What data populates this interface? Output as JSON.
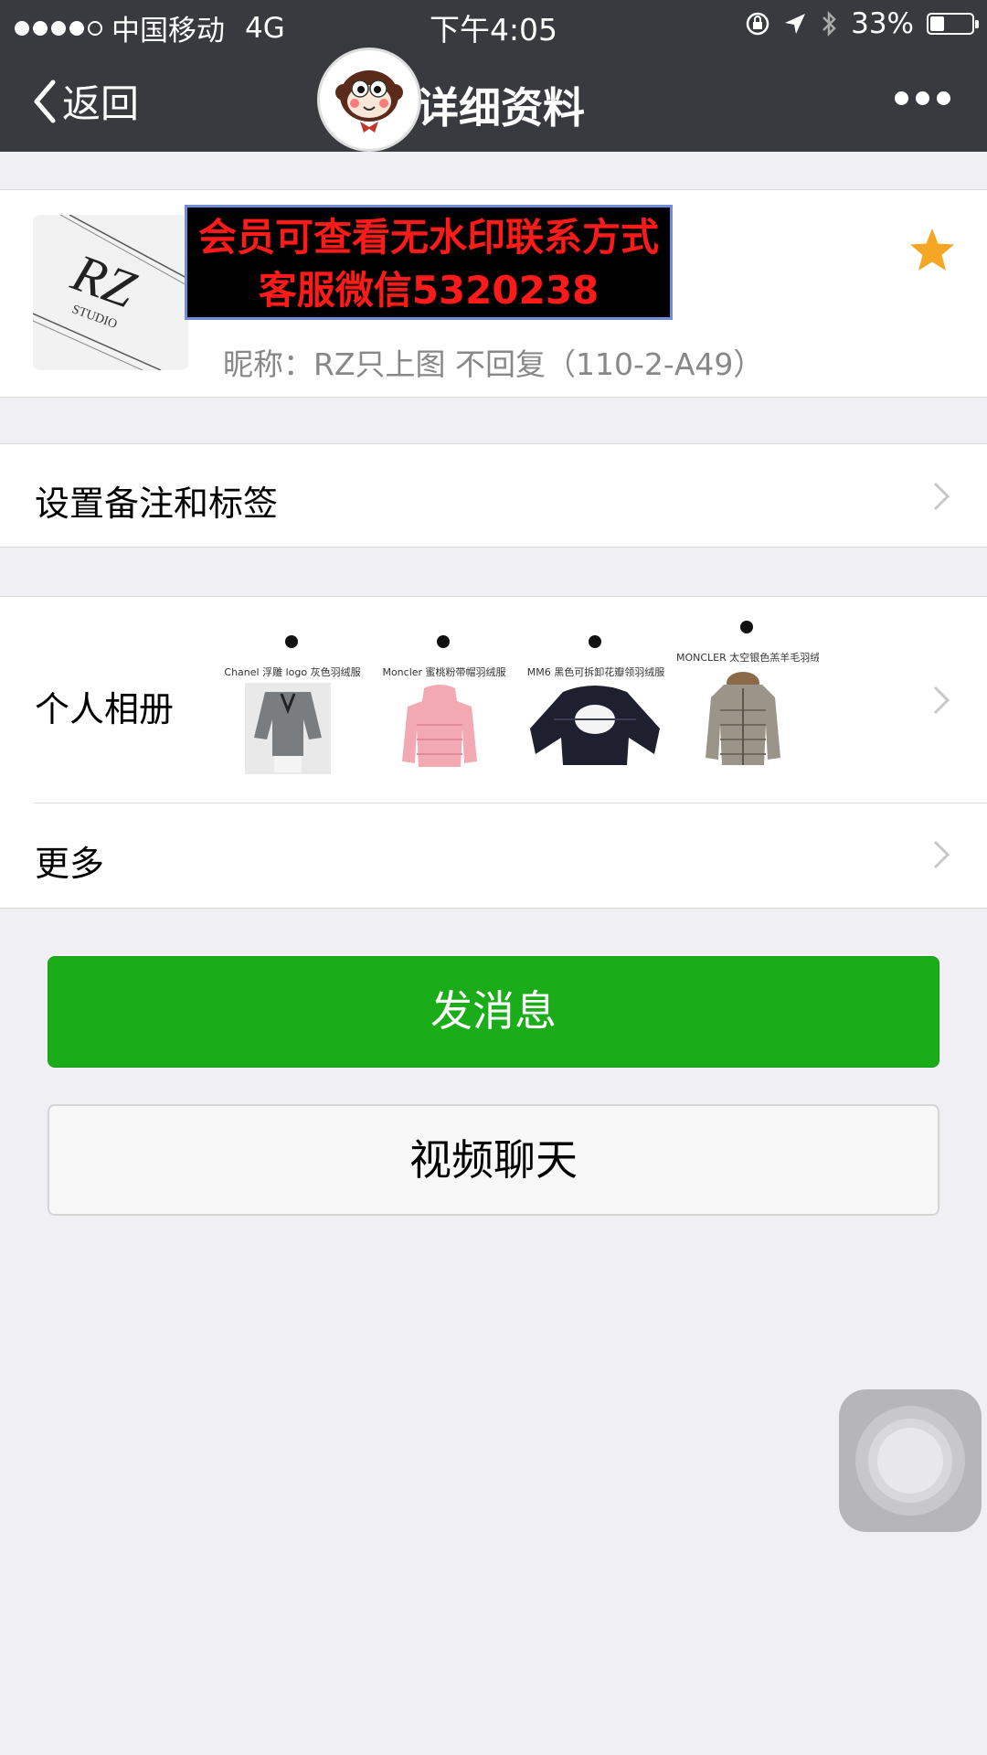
{
  "status_bar": {
    "carrier": "中国移动",
    "network": "4G",
    "time": "下午4:05",
    "battery": "33%",
    "battery_level": 0.33
  },
  "nav": {
    "back_label": "返回",
    "title": "详细资料"
  },
  "profile": {
    "watermark_line1": "会员可查看无水印联系方式",
    "watermark_line2": "客服微信5320238",
    "nickname": "昵称：RZ只上图 不回复（110-2-A49）",
    "starred": true
  },
  "rows": {
    "remarks_label": "设置备注和标签",
    "album_label": "个人相册",
    "more_label": "更多"
  },
  "album": [
    {
      "caption": "Chanel 浮雕 logo 灰色羽绒服"
    },
    {
      "caption": "Moncler 蜜桃粉带帽羽绒服"
    },
    {
      "caption": "MM6 黑色可拆卸花瓣领羽绒服"
    },
    {
      "caption": "MONCLER 太空银色羔羊毛羽绒服"
    }
  ],
  "buttons": {
    "message": "发消息",
    "video_call": "视频聊天"
  },
  "colors": {
    "primary_green": "#1aad19",
    "nav_bg": "#393a3f",
    "star": "#f5a623"
  }
}
